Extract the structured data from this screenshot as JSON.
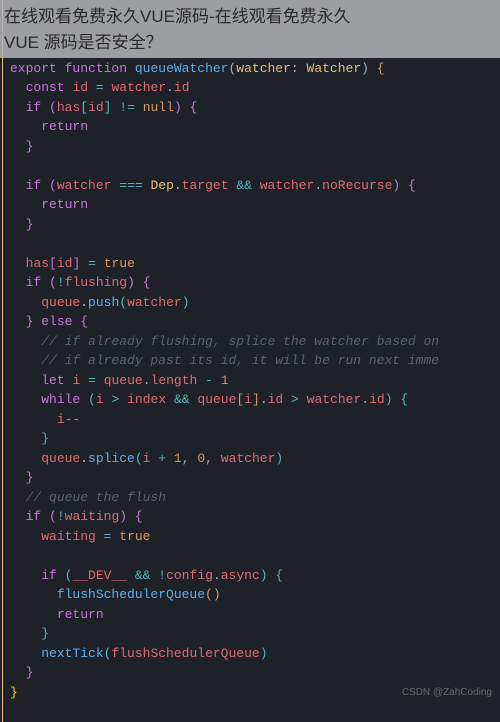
{
  "overlay": {
    "line1": "在线观看免费永久VUE源码-在线观看免费永久",
    "line2": "VUE 源码是否安全？"
  },
  "code": {
    "lines": [
      {
        "indent": 0,
        "tokens": [
          {
            "t": "kw",
            "v": "export"
          },
          {
            "t": "plain",
            "v": " "
          },
          {
            "t": "kw",
            "v": "function"
          },
          {
            "t": "plain",
            "v": " "
          },
          {
            "t": "fn",
            "v": "queueWatcher"
          },
          {
            "t": "punct",
            "v": "("
          },
          {
            "t": "param",
            "v": "watcher"
          },
          {
            "t": "punct",
            "v": ": "
          },
          {
            "t": "param",
            "v": "Watcher"
          },
          {
            "t": "punct",
            "v": ") "
          },
          {
            "t": "bracket1",
            "v": "{"
          }
        ]
      },
      {
        "indent": 1,
        "tokens": [
          {
            "t": "kw",
            "v": "const"
          },
          {
            "t": "plain",
            "v": " "
          },
          {
            "t": "prop",
            "v": "id"
          },
          {
            "t": "plain",
            "v": " "
          },
          {
            "t": "op",
            "v": "="
          },
          {
            "t": "plain",
            "v": " "
          },
          {
            "t": "prop",
            "v": "watcher"
          },
          {
            "t": "punct",
            "v": "."
          },
          {
            "t": "prop",
            "v": "id"
          }
        ]
      },
      {
        "indent": 1,
        "tokens": [
          {
            "t": "kw",
            "v": "if"
          },
          {
            "t": "plain",
            "v": " "
          },
          {
            "t": "bracket2",
            "v": "("
          },
          {
            "t": "prop",
            "v": "has"
          },
          {
            "t": "bracket3",
            "v": "["
          },
          {
            "t": "prop",
            "v": "id"
          },
          {
            "t": "bracket3",
            "v": "]"
          },
          {
            "t": "plain",
            "v": " "
          },
          {
            "t": "op",
            "v": "!="
          },
          {
            "t": "plain",
            "v": " "
          },
          {
            "t": "bool",
            "v": "null"
          },
          {
            "t": "bracket2",
            "v": ")"
          },
          {
            "t": "plain",
            "v": " "
          },
          {
            "t": "bracket2",
            "v": "{"
          }
        ]
      },
      {
        "indent": 2,
        "tokens": [
          {
            "t": "kw",
            "v": "return"
          }
        ]
      },
      {
        "indent": 1,
        "tokens": [
          {
            "t": "bracket2",
            "v": "}"
          }
        ]
      },
      {
        "indent": 0,
        "tokens": []
      },
      {
        "indent": 1,
        "tokens": [
          {
            "t": "kw",
            "v": "if"
          },
          {
            "t": "plain",
            "v": " "
          },
          {
            "t": "bracket2",
            "v": "("
          },
          {
            "t": "prop",
            "v": "watcher"
          },
          {
            "t": "plain",
            "v": " "
          },
          {
            "t": "op",
            "v": "==="
          },
          {
            "t": "plain",
            "v": " "
          },
          {
            "t": "param",
            "v": "Dep"
          },
          {
            "t": "punct",
            "v": "."
          },
          {
            "t": "prop",
            "v": "target"
          },
          {
            "t": "plain",
            "v": " "
          },
          {
            "t": "op",
            "v": "&&"
          },
          {
            "t": "plain",
            "v": " "
          },
          {
            "t": "prop",
            "v": "watcher"
          },
          {
            "t": "punct",
            "v": "."
          },
          {
            "t": "prop",
            "v": "noRecurse"
          },
          {
            "t": "bracket2",
            "v": ")"
          },
          {
            "t": "plain",
            "v": " "
          },
          {
            "t": "bracket2",
            "v": "{"
          }
        ]
      },
      {
        "indent": 2,
        "tokens": [
          {
            "t": "kw",
            "v": "return"
          }
        ]
      },
      {
        "indent": 1,
        "tokens": [
          {
            "t": "bracket2",
            "v": "}"
          }
        ]
      },
      {
        "indent": 0,
        "tokens": []
      },
      {
        "indent": 1,
        "tokens": [
          {
            "t": "prop",
            "v": "has"
          },
          {
            "t": "bracket2",
            "v": "["
          },
          {
            "t": "prop",
            "v": "id"
          },
          {
            "t": "bracket2",
            "v": "]"
          },
          {
            "t": "plain",
            "v": " "
          },
          {
            "t": "op",
            "v": "="
          },
          {
            "t": "plain",
            "v": " "
          },
          {
            "t": "bool",
            "v": "true"
          }
        ]
      },
      {
        "indent": 1,
        "tokens": [
          {
            "t": "kw",
            "v": "if"
          },
          {
            "t": "plain",
            "v": " "
          },
          {
            "t": "bracket2",
            "v": "("
          },
          {
            "t": "op",
            "v": "!"
          },
          {
            "t": "prop",
            "v": "flushing"
          },
          {
            "t": "bracket2",
            "v": ")"
          },
          {
            "t": "plain",
            "v": " "
          },
          {
            "t": "bracket2",
            "v": "{"
          }
        ]
      },
      {
        "indent": 2,
        "tokens": [
          {
            "t": "prop",
            "v": "queue"
          },
          {
            "t": "punct",
            "v": "."
          },
          {
            "t": "fn",
            "v": "push"
          },
          {
            "t": "bracket3",
            "v": "("
          },
          {
            "t": "prop",
            "v": "watcher"
          },
          {
            "t": "bracket3",
            "v": ")"
          }
        ]
      },
      {
        "indent": 1,
        "tokens": [
          {
            "t": "bracket2",
            "v": "}"
          },
          {
            "t": "plain",
            "v": " "
          },
          {
            "t": "kw",
            "v": "else"
          },
          {
            "t": "plain",
            "v": " "
          },
          {
            "t": "bracket2",
            "v": "{"
          }
        ]
      },
      {
        "indent": 2,
        "tokens": [
          {
            "t": "comment",
            "v": "// if already flushing, splice the watcher based on"
          }
        ]
      },
      {
        "indent": 2,
        "tokens": [
          {
            "t": "comment",
            "v": "// if already past its id, it will be run next imme"
          }
        ]
      },
      {
        "indent": 2,
        "tokens": [
          {
            "t": "kw",
            "v": "let"
          },
          {
            "t": "plain",
            "v": " "
          },
          {
            "t": "prop",
            "v": "i"
          },
          {
            "t": "plain",
            "v": " "
          },
          {
            "t": "op",
            "v": "="
          },
          {
            "t": "plain",
            "v": " "
          },
          {
            "t": "prop",
            "v": "queue"
          },
          {
            "t": "punct",
            "v": "."
          },
          {
            "t": "prop",
            "v": "length"
          },
          {
            "t": "plain",
            "v": " "
          },
          {
            "t": "op",
            "v": "-"
          },
          {
            "t": "plain",
            "v": " "
          },
          {
            "t": "num",
            "v": "1"
          }
        ]
      },
      {
        "indent": 2,
        "tokens": [
          {
            "t": "kw",
            "v": "while"
          },
          {
            "t": "plain",
            "v": " "
          },
          {
            "t": "bracket3",
            "v": "("
          },
          {
            "t": "prop",
            "v": "i"
          },
          {
            "t": "plain",
            "v": " "
          },
          {
            "t": "op",
            "v": ">"
          },
          {
            "t": "plain",
            "v": " "
          },
          {
            "t": "prop",
            "v": "index"
          },
          {
            "t": "plain",
            "v": " "
          },
          {
            "t": "op",
            "v": "&&"
          },
          {
            "t": "plain",
            "v": " "
          },
          {
            "t": "prop",
            "v": "queue"
          },
          {
            "t": "bracket1",
            "v": "["
          },
          {
            "t": "prop",
            "v": "i"
          },
          {
            "t": "bracket1",
            "v": "]"
          },
          {
            "t": "punct",
            "v": "."
          },
          {
            "t": "prop",
            "v": "id"
          },
          {
            "t": "plain",
            "v": " "
          },
          {
            "t": "op",
            "v": ">"
          },
          {
            "t": "plain",
            "v": " "
          },
          {
            "t": "prop",
            "v": "watcher"
          },
          {
            "t": "punct",
            "v": "."
          },
          {
            "t": "prop",
            "v": "id"
          },
          {
            "t": "bracket3",
            "v": ")"
          },
          {
            "t": "plain",
            "v": " "
          },
          {
            "t": "bracket3",
            "v": "{"
          }
        ]
      },
      {
        "indent": 3,
        "tokens": [
          {
            "t": "prop",
            "v": "i"
          },
          {
            "t": "op",
            "v": "--"
          }
        ]
      },
      {
        "indent": 2,
        "tokens": [
          {
            "t": "bracket3",
            "v": "}"
          }
        ]
      },
      {
        "indent": 2,
        "tokens": [
          {
            "t": "prop",
            "v": "queue"
          },
          {
            "t": "punct",
            "v": "."
          },
          {
            "t": "fn",
            "v": "splice"
          },
          {
            "t": "bracket3",
            "v": "("
          },
          {
            "t": "prop",
            "v": "i"
          },
          {
            "t": "plain",
            "v": " "
          },
          {
            "t": "op",
            "v": "+"
          },
          {
            "t": "plain",
            "v": " "
          },
          {
            "t": "num",
            "v": "1"
          },
          {
            "t": "punct",
            "v": ", "
          },
          {
            "t": "num",
            "v": "0"
          },
          {
            "t": "punct",
            "v": ", "
          },
          {
            "t": "prop",
            "v": "watcher"
          },
          {
            "t": "bracket3",
            "v": ")"
          }
        ]
      },
      {
        "indent": 1,
        "tokens": [
          {
            "t": "bracket2",
            "v": "}"
          }
        ]
      },
      {
        "indent": 1,
        "tokens": [
          {
            "t": "comment",
            "v": "// queue the flush"
          }
        ]
      },
      {
        "indent": 1,
        "tokens": [
          {
            "t": "kw",
            "v": "if"
          },
          {
            "t": "plain",
            "v": " "
          },
          {
            "t": "bracket2",
            "v": "("
          },
          {
            "t": "op",
            "v": "!"
          },
          {
            "t": "prop",
            "v": "waiting"
          },
          {
            "t": "bracket2",
            "v": ")"
          },
          {
            "t": "plain",
            "v": " "
          },
          {
            "t": "bracket2",
            "v": "{"
          }
        ]
      },
      {
        "indent": 2,
        "tokens": [
          {
            "t": "prop",
            "v": "waiting"
          },
          {
            "t": "plain",
            "v": " "
          },
          {
            "t": "op",
            "v": "="
          },
          {
            "t": "plain",
            "v": " "
          },
          {
            "t": "bool",
            "v": "true"
          }
        ]
      },
      {
        "indent": 0,
        "tokens": []
      },
      {
        "indent": 2,
        "tokens": [
          {
            "t": "kw",
            "v": "if"
          },
          {
            "t": "plain",
            "v": " "
          },
          {
            "t": "bracket3",
            "v": "("
          },
          {
            "t": "prop",
            "v": "__DEV__"
          },
          {
            "t": "plain",
            "v": " "
          },
          {
            "t": "op",
            "v": "&&"
          },
          {
            "t": "plain",
            "v": " "
          },
          {
            "t": "op",
            "v": "!"
          },
          {
            "t": "prop",
            "v": "config"
          },
          {
            "t": "punct",
            "v": "."
          },
          {
            "t": "prop",
            "v": "async"
          },
          {
            "t": "bracket3",
            "v": ")"
          },
          {
            "t": "plain",
            "v": " "
          },
          {
            "t": "bracket3",
            "v": "{"
          }
        ]
      },
      {
        "indent": 3,
        "tokens": [
          {
            "t": "fn",
            "v": "flushSchedulerQueue"
          },
          {
            "t": "bracket1",
            "v": "("
          },
          {
            "t": "bracket1",
            "v": ")"
          }
        ]
      },
      {
        "indent": 3,
        "tokens": [
          {
            "t": "kw",
            "v": "return"
          }
        ]
      },
      {
        "indent": 2,
        "tokens": [
          {
            "t": "bracket3",
            "v": "}"
          }
        ]
      },
      {
        "indent": 2,
        "tokens": [
          {
            "t": "fn",
            "v": "nextTick"
          },
          {
            "t": "bracket3",
            "v": "("
          },
          {
            "t": "prop",
            "v": "flushSchedulerQueue"
          },
          {
            "t": "bracket3",
            "v": ")"
          }
        ]
      },
      {
        "indent": 1,
        "tokens": [
          {
            "t": "bracket2",
            "v": "}"
          }
        ]
      },
      {
        "indent": 0,
        "tokens": [
          {
            "t": "highlight-bracket",
            "v": "}"
          }
        ]
      }
    ]
  },
  "watermark": "CSDN @ZahCoding"
}
